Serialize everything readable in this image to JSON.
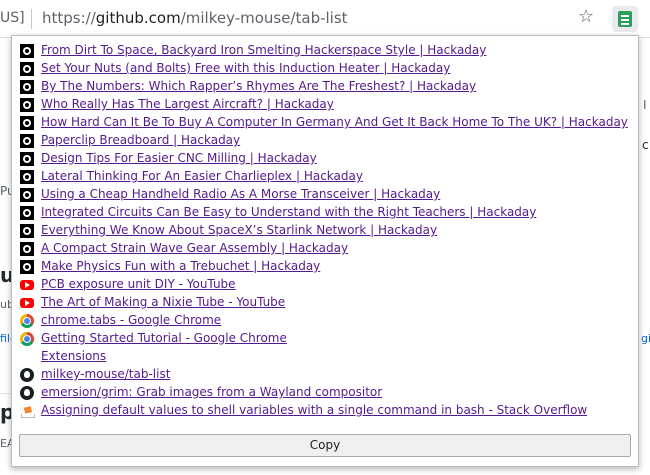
{
  "browser": {
    "tab_fragment": "US]",
    "url_scheme": "https://",
    "url_host": "github.com",
    "url_path": "/milkey-mouse/tab-list",
    "star_icon": "☆",
    "extension_icon": "tab-list-extension-icon"
  },
  "background": {
    "frag_pu": "Pu",
    "frag_u": "u",
    "frag_ub": "ub",
    "frag_file": "file",
    "frag_p": "p",
    "frag_ea": "EA",
    "frag_right_top": "I",
    "frag_right_c": "c",
    "frag_right_gi": "gi"
  },
  "popup": {
    "tabs": [
      {
        "title": "From Dirt To Space, Backyard Iron Smelting Hackerspace Style | Hackaday",
        "favicon": "hackaday"
      },
      {
        "title": "Set Your Nuts (and Bolts) Free with this Induction Heater | Hackaday",
        "favicon": "hackaday"
      },
      {
        "title": "By The Numbers: Which Rapper’s Rhymes Are The Freshest? | Hackaday",
        "favicon": "hackaday"
      },
      {
        "title": "Who Really Has The Largest Aircraft? | Hackaday",
        "favicon": "hackaday"
      },
      {
        "title": "How Hard Can It Be To Buy A Computer In Germany And Get It Back Home To The UK? | Hackaday",
        "favicon": "hackaday"
      },
      {
        "title": "Paperclip Breadboard | Hackaday",
        "favicon": "hackaday"
      },
      {
        "title": "Design Tips For Easier CNC Milling | Hackaday",
        "favicon": "hackaday"
      },
      {
        "title": "Lateral Thinking For An Easier Charlieplex | Hackaday",
        "favicon": "hackaday"
      },
      {
        "title": "Using a Cheap Handheld Radio As A Morse Transceiver | Hackaday",
        "favicon": "hackaday"
      },
      {
        "title": "Integrated Circuits Can Be Easy to Understand with the Right Teachers | Hackaday",
        "favicon": "hackaday"
      },
      {
        "title": "Everything We Know About SpaceX’s Starlink Network | Hackaday",
        "favicon": "hackaday"
      },
      {
        "title": "A Compact Strain Wave Gear Assembly | Hackaday",
        "favicon": "hackaday"
      },
      {
        "title": "Make Physics Fun with a Trebuchet | Hackaday",
        "favicon": "hackaday"
      },
      {
        "title": "PCB exposure unit DIY - YouTube",
        "favicon": "youtube"
      },
      {
        "title": "The Art of Making a Nixie Tube - YouTube",
        "favicon": "youtube"
      },
      {
        "title": "chrome.tabs - Google Chrome",
        "favicon": "chrome"
      },
      {
        "title": "Getting Started Tutorial - Google Chrome",
        "favicon": "chrome"
      },
      {
        "title": "Extensions",
        "favicon": "none"
      },
      {
        "title": "milkey-mouse/tab-list",
        "favicon": "github"
      },
      {
        "title": "emersion/grim: Grab images from a Wayland compositor",
        "favicon": "github"
      },
      {
        "title": "Assigning default values to shell variables with a single command in bash - Stack Overflow",
        "favicon": "stackoverflow"
      }
    ],
    "copy_label": "Copy"
  }
}
